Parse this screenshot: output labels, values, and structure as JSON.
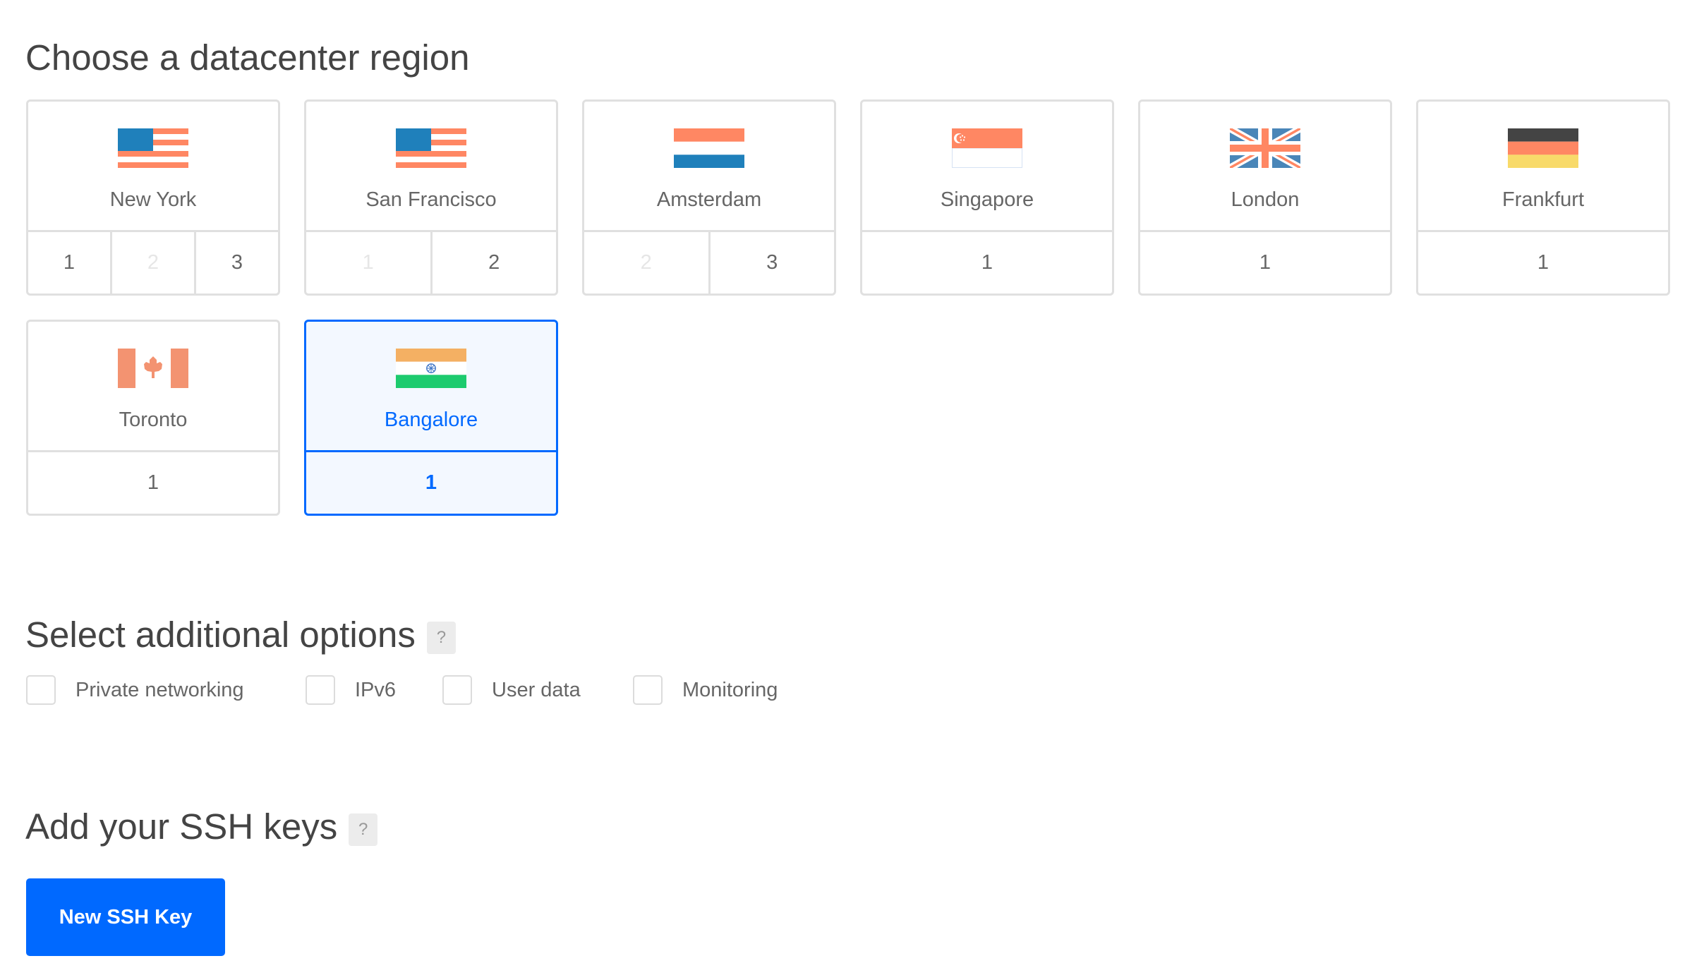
{
  "region_section": {
    "title": "Choose a datacenter region",
    "regions": [
      {
        "name": "New York",
        "flag": "usa-flag-icon",
        "datacenters": [
          {
            "label": "1",
            "available": true
          },
          {
            "label": "2",
            "available": false
          },
          {
            "label": "3",
            "available": true
          }
        ],
        "selected": false
      },
      {
        "name": "San Francisco",
        "flag": "usa-flag-icon",
        "datacenters": [
          {
            "label": "1",
            "available": false
          },
          {
            "label": "2",
            "available": true
          }
        ],
        "selected": false
      },
      {
        "name": "Amsterdam",
        "flag": "netherlands-flag-icon",
        "datacenters": [
          {
            "label": "2",
            "available": false
          },
          {
            "label": "3",
            "available": true
          }
        ],
        "selected": false
      },
      {
        "name": "Singapore",
        "flag": "singapore-flag-icon",
        "datacenters": [
          {
            "label": "1",
            "available": true
          }
        ],
        "selected": false
      },
      {
        "name": "London",
        "flag": "uk-flag-icon",
        "datacenters": [
          {
            "label": "1",
            "available": true
          }
        ],
        "selected": false
      },
      {
        "name": "Frankfurt",
        "flag": "germany-flag-icon",
        "datacenters": [
          {
            "label": "1",
            "available": true
          }
        ],
        "selected": false
      },
      {
        "name": "Toronto",
        "flag": "canada-flag-icon",
        "datacenters": [
          {
            "label": "1",
            "available": true
          }
        ],
        "selected": false
      },
      {
        "name": "Bangalore",
        "flag": "india-flag-icon",
        "datacenters": [
          {
            "label": "1",
            "available": true
          }
        ],
        "selected": true,
        "selected_datacenter": "1"
      }
    ]
  },
  "options_section": {
    "title": "Select additional options",
    "help": "?",
    "options": [
      {
        "label": "Private networking",
        "checked": false
      },
      {
        "label": "IPv6",
        "checked": false
      },
      {
        "label": "User data",
        "checked": false
      },
      {
        "label": "Monitoring",
        "checked": false
      }
    ]
  },
  "ssh_section": {
    "title": "Add your SSH keys",
    "help": "?",
    "new_key_button": "New SSH Key"
  },
  "colors": {
    "accent": "#0069ff",
    "selected_bg": "#f3f8ff",
    "border": "#e0e0e0",
    "flag_red": "#ff8763",
    "flag_blue": "#1f80bb",
    "uk_blue": "#4a86b8",
    "germany_black": "#444444",
    "germany_gold": "#f8da6a",
    "canada_red": "#f39371",
    "india_orange": "#f4b063",
    "india_green": "#1dcb6e"
  }
}
